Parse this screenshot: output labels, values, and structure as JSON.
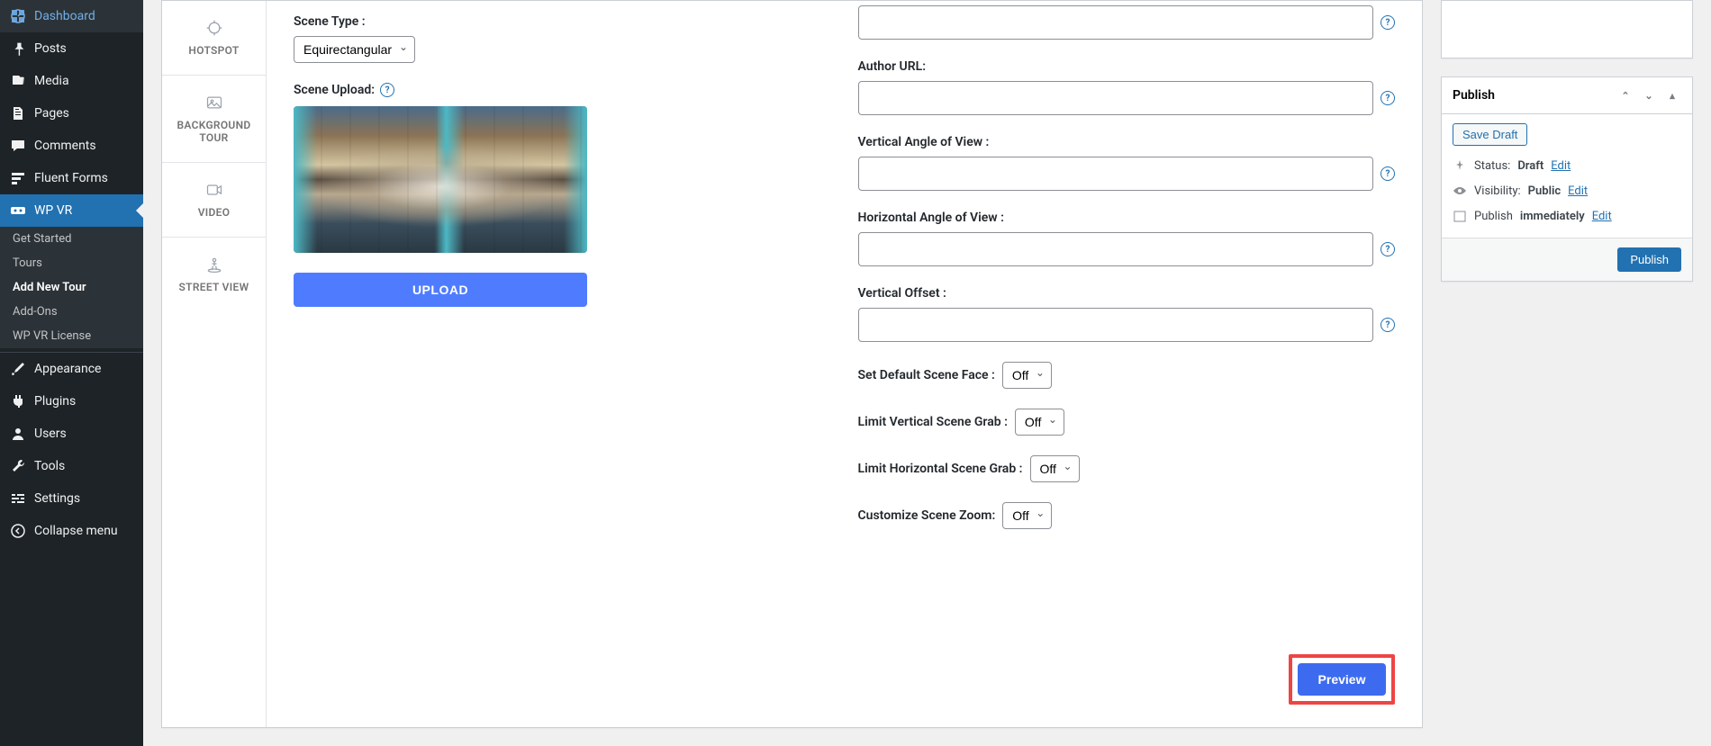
{
  "sidebar": {
    "dashboard": "Dashboard",
    "posts": "Posts",
    "media": "Media",
    "pages": "Pages",
    "comments": "Comments",
    "fluent_forms": "Fluent Forms",
    "wpvr": "WP VR",
    "sub": {
      "get_started": "Get Started",
      "tours": "Tours",
      "add_new_tour": "Add New Tour",
      "addons": "Add-Ons",
      "license": "WP VR License"
    },
    "appearance": "Appearance",
    "plugins": "Plugins",
    "users": "Users",
    "tools": "Tools",
    "settings": "Settings",
    "collapse": "Collapse menu"
  },
  "vtabs": {
    "hotspot": "HOTSPOT",
    "background_tour": "BACKGROUND TOUR",
    "video": "VIDEO",
    "street_view": "STREET VIEW"
  },
  "form": {
    "scene_type_label": "Scene Type :",
    "scene_type_value": "Equirectangular",
    "scene_upload_label": "Scene Upload:",
    "upload_btn": "UPLOAD",
    "author_url_label": "Author URL:",
    "vaov_label": "Vertical Angle of View :",
    "haov_label": "Horizontal Angle of View :",
    "voffset_label": "Vertical Offset :",
    "default_face_label": "Set Default Scene Face :",
    "default_face_value": "Off",
    "limit_v_label": "Limit Vertical Scene Grab :",
    "limit_v_value": "Off",
    "limit_h_label": "Limit Horizontal Scene Grab :",
    "limit_h_value": "Off",
    "zoom_label": "Customize Scene Zoom:",
    "zoom_value": "Off",
    "preview_btn": "Preview"
  },
  "publish": {
    "title": "Publish",
    "save_draft": "Save Draft",
    "status_label": "Status:",
    "status_value": "Draft",
    "visibility_label": "Visibility:",
    "visibility_value": "Public",
    "publish_label": "Publish",
    "publish_value": "immediately",
    "edit": "Edit",
    "publish_btn": "Publish"
  }
}
